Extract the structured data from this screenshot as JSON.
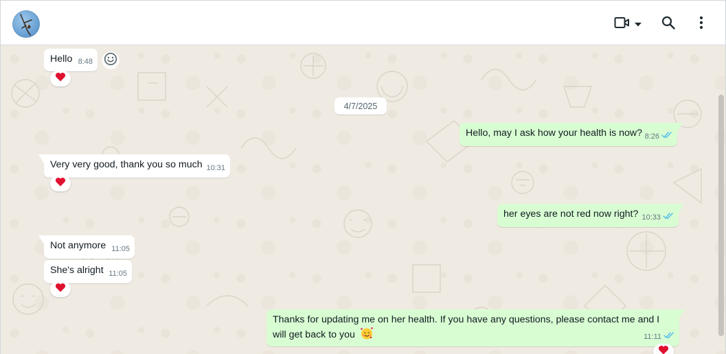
{
  "header": {
    "avatar": "contact-avatar",
    "icons": {
      "video": "video-camera-icon",
      "dropdown": "caret-down-icon",
      "search": "search-icon",
      "menu": "more-vertical-icon"
    }
  },
  "chat": {
    "date_separator": "4/7/2025",
    "messages": [
      {
        "direction": "in",
        "text": "Hello",
        "time": "8:48",
        "reaction": "heart"
      },
      {
        "direction": "out",
        "text": "Hello, may I ask how your health is now?",
        "time": "8:26",
        "status": "read"
      },
      {
        "direction": "in",
        "text": "Very very good, thank you so much",
        "time": "10:31",
        "reaction": "heart"
      },
      {
        "direction": "out",
        "text": "her eyes are not red now right?",
        "time": "10:33",
        "status": "read"
      },
      {
        "direction": "in",
        "text": "Not anymore",
        "time": "11:05"
      },
      {
        "direction": "in",
        "text": "She's alright",
        "time": "11:05",
        "reaction": "heart"
      },
      {
        "direction": "out",
        "text_line1": "Thanks for updating me on her health. If you have any questions, please contact me and I",
        "text_line2": "will get back to you",
        "emoji": "smiling-face-with-hearts",
        "time": "11:11",
        "status": "read",
        "reaction": "heart"
      }
    ]
  },
  "colors": {
    "incoming": "#ffffff",
    "outgoing": "#d9fdd3",
    "read_ticks": "#53bdeb",
    "heart": "#e0102f",
    "background": "#efeae2"
  }
}
